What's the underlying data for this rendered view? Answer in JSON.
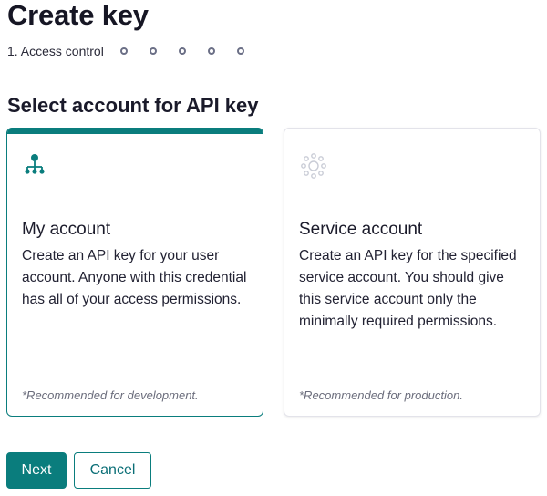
{
  "page": {
    "title": "Create key"
  },
  "stepper": {
    "current_step_label": "1. Access control",
    "remaining_steps": 5
  },
  "section": {
    "title": "Select account for API key"
  },
  "cards": [
    {
      "heading": "My account",
      "body": "Create an API key for your user account. Anyone with this credential has all of your access permissions.",
      "note": "*Recommended for development.",
      "selected": true,
      "icon": "org-chart-icon"
    },
    {
      "heading": "Service account",
      "body": "Create an API key for the specified service account. You should give this service account only the minimally required permissions.",
      "note": "*Recommended for production.",
      "selected": false,
      "icon": "network-hub-icon"
    }
  ],
  "buttons": {
    "next": "Next",
    "cancel": "Cancel"
  },
  "colors": {
    "accent": "#0a7d7d",
    "step_dot": "#6b6f86",
    "unselected_icon": "#c9ccd6"
  }
}
